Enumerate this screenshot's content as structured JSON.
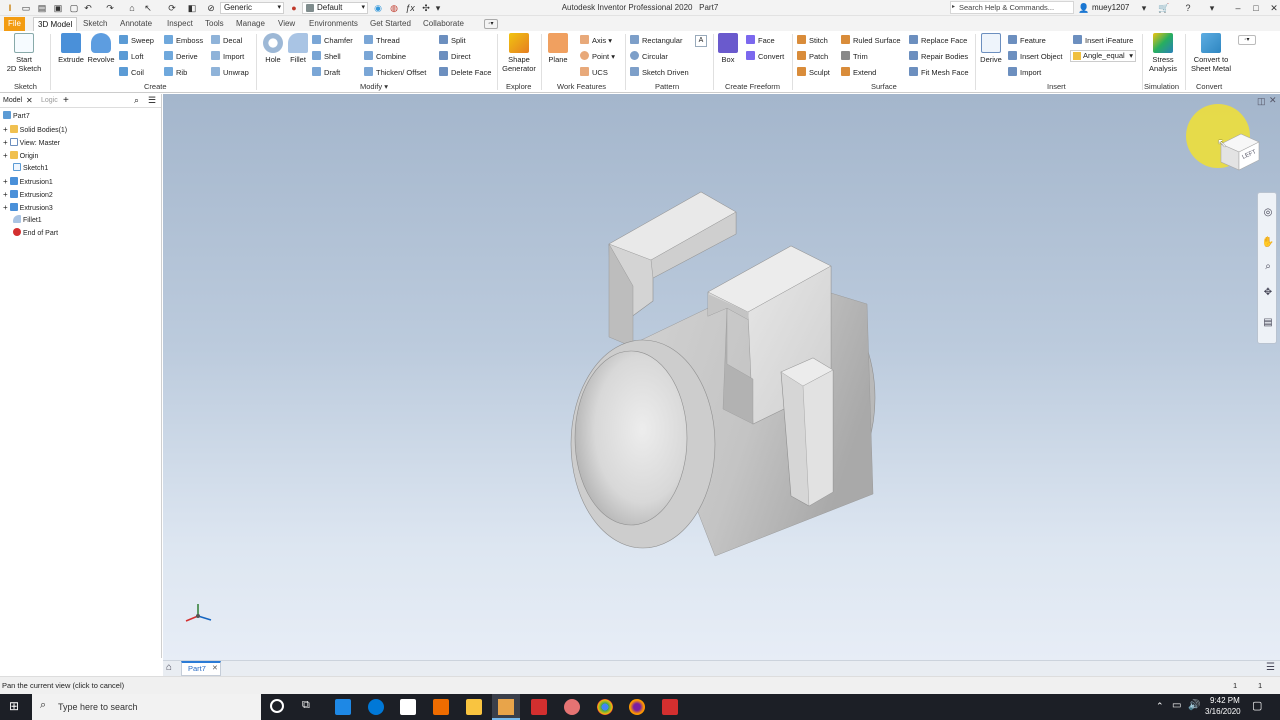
{
  "app": {
    "title": "Autodesk Inventor Professional 2020",
    "document": "Part7",
    "search_placeholder": "Search Help & Commands...",
    "user": "muey1207",
    "material": "Generic",
    "appearance": "Default"
  },
  "tabs": [
    {
      "label": "File"
    },
    {
      "label": "3D Model"
    },
    {
      "label": "Sketch"
    },
    {
      "label": "Annotate"
    },
    {
      "label": "Inspect"
    },
    {
      "label": "Tools"
    },
    {
      "label": "Manage"
    },
    {
      "label": "View"
    },
    {
      "label": "Environments"
    },
    {
      "label": "Get Started"
    },
    {
      "label": "Collaborate"
    }
  ],
  "ribbon": {
    "sketch": {
      "start": "Start\n2D Sketch",
      "panel": "Sketch"
    },
    "create": {
      "extrude": "Extrude",
      "revolve": "Revolve",
      "sweep": "Sweep",
      "loft": "Loft",
      "coil": "Coil",
      "emboss": "Emboss",
      "derive": "Derive",
      "rib": "Rib",
      "decal": "Decal",
      "import": "Import",
      "unwrap": "Unwrap",
      "panel": "Create"
    },
    "modify": {
      "hole": "Hole",
      "fillet": "Fillet",
      "chamfer": "Chamfer",
      "shell": "Shell",
      "draft": "Draft",
      "thread": "Thread",
      "combine": "Combine",
      "thicken": "Thicken/ Offset",
      "split": "Split",
      "direct": "Direct",
      "delete_face": "Delete Face",
      "panel": "Modify"
    },
    "explore": {
      "shape_generator": "Shape\nGenerator",
      "panel": "Explore"
    },
    "work": {
      "plane": "Plane",
      "axis": "Axis",
      "point": "Point",
      "ucs": "UCS",
      "panel": "Work Features"
    },
    "pattern": {
      "rectangular": "Rectangular",
      "circular": "Circular",
      "sketch_driven": "Sketch Driven",
      "panel": "Pattern"
    },
    "freeform": {
      "box": "Box",
      "face": "Face",
      "convert": "Convert",
      "panel": "Create Freeform"
    },
    "surface": {
      "stitch": "Stitch",
      "patch": "Patch",
      "sculpt": "Sculpt",
      "ruled": "Ruled Surface",
      "trim": "Trim",
      "extend": "Extend",
      "replace": "Replace Face",
      "repair": "Repair Bodies",
      "fit_mesh": "Fit Mesh Face",
      "panel": "Surface"
    },
    "insert": {
      "derive": "Derive",
      "feature": "Feature",
      "insert_object": "Insert Object",
      "import": "Import",
      "ifeature": "Insert iFeature",
      "angle": "Angle_equal",
      "panel": "Insert"
    },
    "simulation": {
      "stress": "Stress\nAnalysis",
      "panel": "Simulation"
    },
    "convert": {
      "sheet_metal": "Convert to\nSheet Metal",
      "panel": "Convert"
    }
  },
  "browser": {
    "tab_model": "Model",
    "tab_logic": "Logic",
    "items": [
      {
        "label": "Part7",
        "icon": "part-icon"
      },
      {
        "label": "Solid Bodies(1)",
        "icon": "folder-icon"
      },
      {
        "label": "View: Master",
        "icon": "view-icon"
      },
      {
        "label": "Origin",
        "icon": "folder-icon"
      },
      {
        "label": "Sketch1",
        "icon": "sketch-icon"
      },
      {
        "label": "Extrusion1",
        "icon": "extrude-icon"
      },
      {
        "label": "Extrusion2",
        "icon": "extrude-icon"
      },
      {
        "label": "Extrusion3",
        "icon": "extrude-icon"
      },
      {
        "label": "Fillet1",
        "icon": "fillet-icon"
      },
      {
        "label": "End of Part",
        "icon": "end-of-part-icon"
      }
    ]
  },
  "viewcube": {
    "face": "LEFT"
  },
  "document_tab": "Part7",
  "status": {
    "text": "Pan the current view (click to cancel)",
    "count1": "1",
    "count2": "1"
  },
  "taskbar": {
    "search": "Type here to search",
    "time": "9:42 PM",
    "date": "3/16/2020"
  },
  "colors": {
    "accent": "#f39c12",
    "viewport_top": "#a4b6cc",
    "viewport_bottom": "#e7edf6",
    "taskbar": "#1c1f26"
  }
}
